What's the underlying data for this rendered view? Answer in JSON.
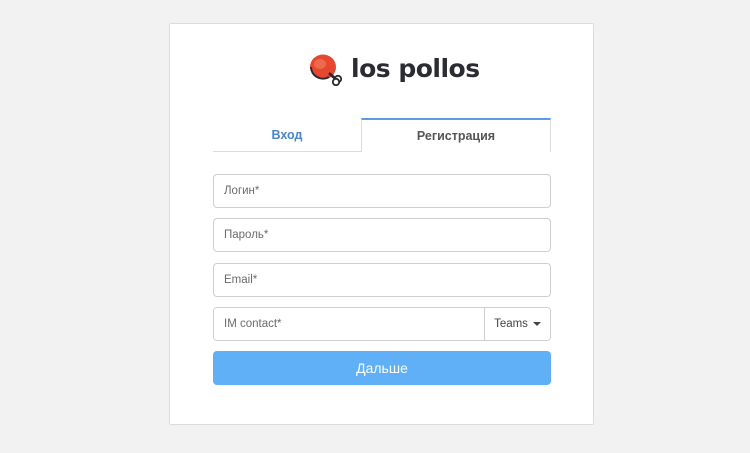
{
  "brand": {
    "logo_text": "los pollos",
    "accent_color": "#e8472f"
  },
  "tabs": [
    {
      "label": "Вход",
      "active": false
    },
    {
      "label": "Регистрация",
      "active": true
    }
  ],
  "form": {
    "login_placeholder": "Логин*",
    "password_placeholder": "Пароль*",
    "email_placeholder": "Email*",
    "im_placeholder": "IM contact*",
    "im_type_selected": "Teams",
    "submit_label": "Дальше"
  }
}
